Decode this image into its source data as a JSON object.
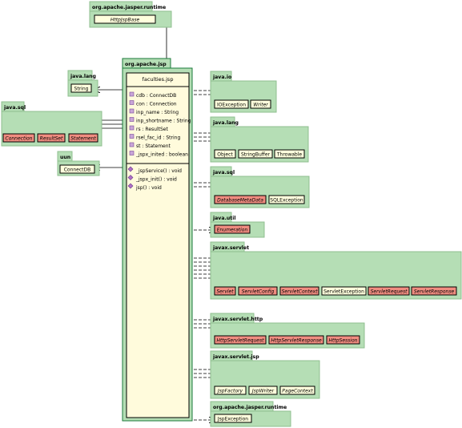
{
  "packages": [
    {
      "id": "pkg-jasper-top",
      "label": "org.apache.jasper.runtime",
      "classes": [
        {
          "label": "HttpJspBase",
          "italic": true,
          "abstract": false
        }
      ]
    },
    {
      "id": "pkg-java-lang-left",
      "label": "java.lang",
      "classes": [
        {
          "label": "String",
          "italic": false,
          "abstract": false
        }
      ]
    },
    {
      "id": "pkg-java-sql-left",
      "label": "java.sql",
      "classes": [
        {
          "label": "Connection",
          "italic": true,
          "abstract": true
        },
        {
          "label": "ResultSet",
          "italic": true,
          "abstract": true
        },
        {
          "label": "Statement",
          "italic": true,
          "abstract": true
        }
      ]
    },
    {
      "id": "pkg-uun",
      "label": "uun",
      "classes": [
        {
          "label": "ConnectDB",
          "italic": false,
          "abstract": false
        }
      ]
    },
    {
      "id": "pkg-java-io",
      "label": "java.io",
      "classes": [
        {
          "label": "IOException",
          "italic": false,
          "abstract": false
        },
        {
          "label": "Writer",
          "italic": true,
          "abstract": false
        }
      ]
    },
    {
      "id": "pkg-java-lang-right",
      "label": "java.lang",
      "classes": [
        {
          "label": "Object",
          "italic": false,
          "abstract": false
        },
        {
          "label": "StringBuffer",
          "italic": false,
          "abstract": false
        },
        {
          "label": "Throwable",
          "italic": false,
          "abstract": false
        }
      ]
    },
    {
      "id": "pkg-java-sql-right",
      "label": "java.sql",
      "classes": [
        {
          "label": "DatabaseMetaData",
          "italic": true,
          "abstract": true
        },
        {
          "label": "SQLException",
          "italic": false,
          "abstract": false
        }
      ]
    },
    {
      "id": "pkg-java-util",
      "label": "java.util",
      "classes": [
        {
          "label": "Enumeration",
          "italic": true,
          "abstract": true
        }
      ]
    },
    {
      "id": "pkg-javax-servlet",
      "label": "javax.servlet",
      "classes": [
        {
          "label": "Servlet",
          "italic": true,
          "abstract": true
        },
        {
          "label": "ServletConfig",
          "italic": true,
          "abstract": true
        },
        {
          "label": "ServletContext",
          "italic": true,
          "abstract": true
        },
        {
          "label": "ServletException",
          "italic": false,
          "abstract": false
        },
        {
          "label": "ServletRequest",
          "italic": true,
          "abstract": true
        },
        {
          "label": "ServletResponse",
          "italic": true,
          "abstract": true
        }
      ]
    },
    {
      "id": "pkg-javax-servlet-http",
      "label": "javax.servlet.http",
      "classes": [
        {
          "label": "HttpServletRequest",
          "italic": true,
          "abstract": true
        },
        {
          "label": "HttpServletResponse",
          "italic": true,
          "abstract": true
        },
        {
          "label": "HttpSession",
          "italic": true,
          "abstract": true
        }
      ]
    },
    {
      "id": "pkg-javax-servlet-jsp",
      "label": "javax.servlet.jsp",
      "classes": [
        {
          "label": "JspFactory",
          "italic": true,
          "abstract": false
        },
        {
          "label": "JspWriter",
          "italic": true,
          "abstract": false
        },
        {
          "label": "PageContext",
          "italic": true,
          "abstract": false
        }
      ]
    },
    {
      "id": "pkg-jasper-bottom",
      "label": "org.apache.jasper.runtime",
      "classes": [
        {
          "label": "JspException",
          "italic": false,
          "abstract": false
        }
      ]
    }
  ],
  "main_package": {
    "label": "org.apache.jsp",
    "class_name": "faculties.jsp",
    "attributes": [
      "cdb : ConnectDB",
      "con : Connection",
      "inp_name : String",
      "inp_shortname : String",
      "rs : ResultSet",
      "rsel_fac_id : String",
      "st : Statement",
      "_jspx_inited : boolean"
    ],
    "operations": [
      "_jspService() : void",
      "_jspx_init() : void",
      "jsp() : void"
    ]
  },
  "colors": {
    "package_fill": "#b5deb5",
    "package_border": "#8fbf8f",
    "class_fill": "#ffffdd",
    "abstract_fill": "#f08c80",
    "main_fill": "#fffbdc",
    "main_border": "#1a7a3a",
    "line": "#000000"
  }
}
